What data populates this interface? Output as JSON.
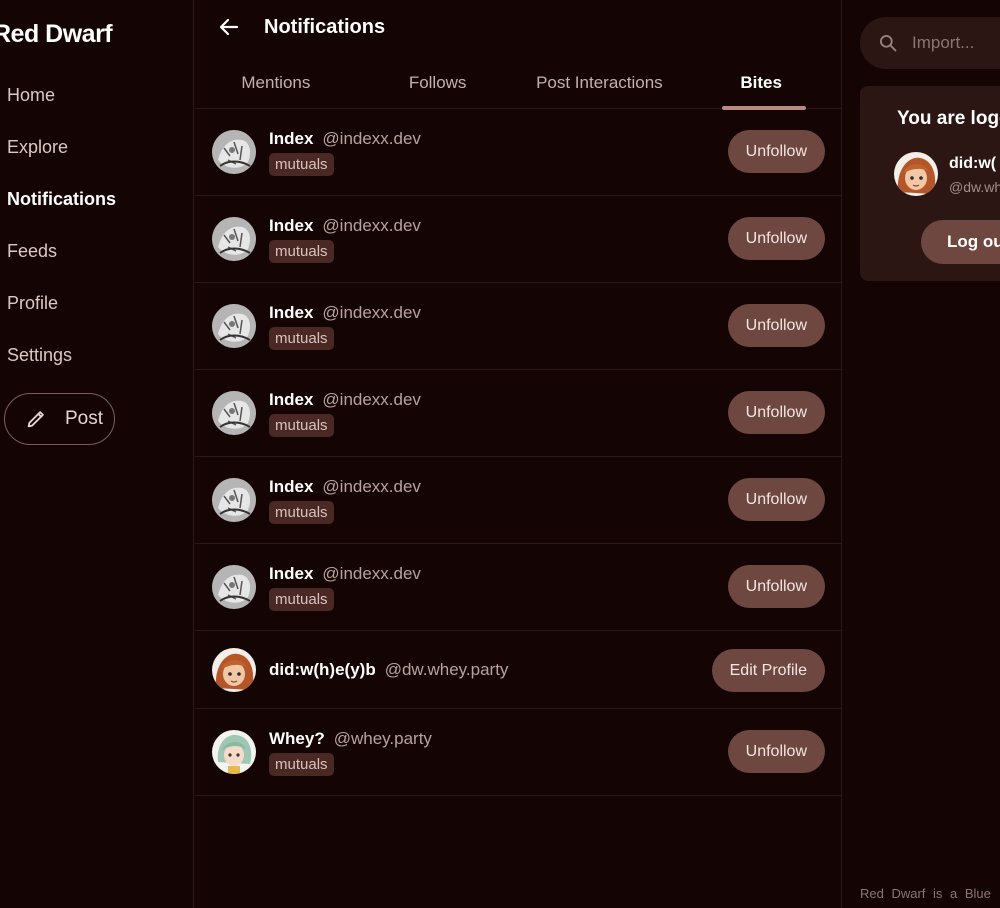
{
  "app": {
    "title": "Red Dwarf"
  },
  "sidebar": {
    "items": [
      {
        "label": "Home",
        "active": false
      },
      {
        "label": "Explore",
        "active": false
      },
      {
        "label": "Notifications",
        "active": true
      },
      {
        "label": "Feeds",
        "active": false
      },
      {
        "label": "Profile",
        "active": false
      },
      {
        "label": "Settings",
        "active": false
      }
    ],
    "post_label": "Post"
  },
  "header": {
    "title": "Notifications"
  },
  "tabs": [
    {
      "label": "Mentions",
      "active": false
    },
    {
      "label": "Follows",
      "active": false
    },
    {
      "label": "Post Interactions",
      "active": false
    },
    {
      "label": "Bites",
      "active": true
    }
  ],
  "notifications": [
    {
      "name": "Index",
      "handle": "@indexx.dev",
      "badge": "mutuals",
      "action": "Unfollow",
      "avatar": "sketch"
    },
    {
      "name": "Index",
      "handle": "@indexx.dev",
      "badge": "mutuals",
      "action": "Unfollow",
      "avatar": "sketch"
    },
    {
      "name": "Index",
      "handle": "@indexx.dev",
      "badge": "mutuals",
      "action": "Unfollow",
      "avatar": "sketch"
    },
    {
      "name": "Index",
      "handle": "@indexx.dev",
      "badge": "mutuals",
      "action": "Unfollow",
      "avatar": "sketch"
    },
    {
      "name": "Index",
      "handle": "@indexx.dev",
      "badge": "mutuals",
      "action": "Unfollow",
      "avatar": "sketch"
    },
    {
      "name": "Index",
      "handle": "@indexx.dev",
      "badge": "mutuals",
      "action": "Unfollow",
      "avatar": "sketch"
    },
    {
      "name": "did:w(h)e(y)b",
      "handle": "@dw.whey.party",
      "badge": "",
      "action": "Edit Profile",
      "avatar": "redhead"
    },
    {
      "name": "Whey?",
      "handle": "@whey.party",
      "badge": "mutuals",
      "action": "Unfollow",
      "avatar": "green"
    }
  ],
  "right_panel": {
    "search_placeholder": "Import...",
    "login_title": "You are logg",
    "account_name": "did:w(",
    "account_handle": "@dw.wh",
    "logout_label": "Log ou",
    "footer_text": "Red Dwarf is a Blue"
  },
  "colors": {
    "background": "#140404",
    "active_nav": "#3f211c",
    "button": "#6f4741",
    "badge": "#4a2924",
    "card": "#2c1614",
    "tab_indicator": "#b88a82"
  }
}
